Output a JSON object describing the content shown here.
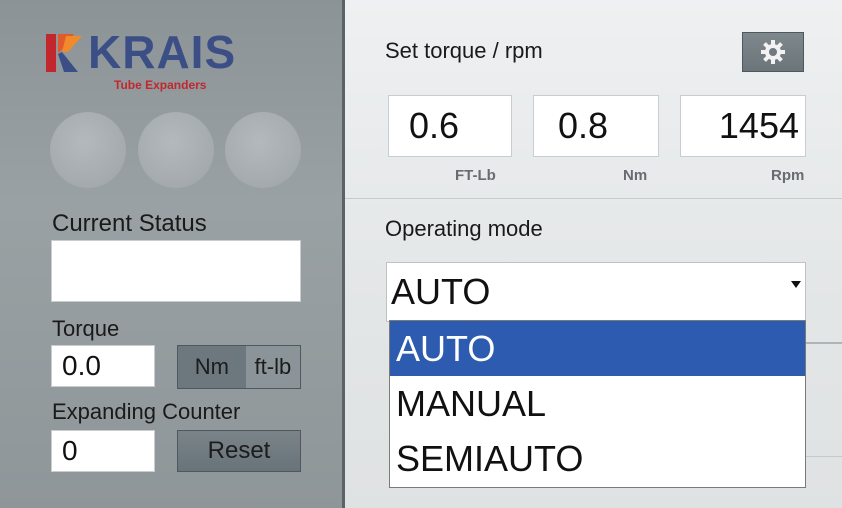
{
  "brand": {
    "name": "KRAIS",
    "tagline": "Tube Expanders",
    "primary_color": "#3b4f86",
    "accent_color": "#c2272d"
  },
  "left": {
    "status_label": "Current Status",
    "status_value": "",
    "torque_label": "Torque",
    "torque_value": "0.0",
    "unit_nm": "Nm",
    "unit_ftlb": "ft-lb",
    "counter_label": "Expanding Counter",
    "counter_value": "0",
    "reset_label": "Reset"
  },
  "right": {
    "set_title": "Set torque / rpm",
    "settings_icon": "gear-icon",
    "ftlb_value": "0.6",
    "nm_value": "0.8",
    "rpm_value": "1454",
    "ftlb_unit": "FT-Lb",
    "nm_unit": "Nm",
    "rpm_unit": "Rpm",
    "mode_label": "Operating mode",
    "mode_selected": "AUTO",
    "mode_options": [
      "AUTO",
      "MANUAL",
      "SEMIAUTO"
    ],
    "highlight_color": "#2c5bb0"
  }
}
